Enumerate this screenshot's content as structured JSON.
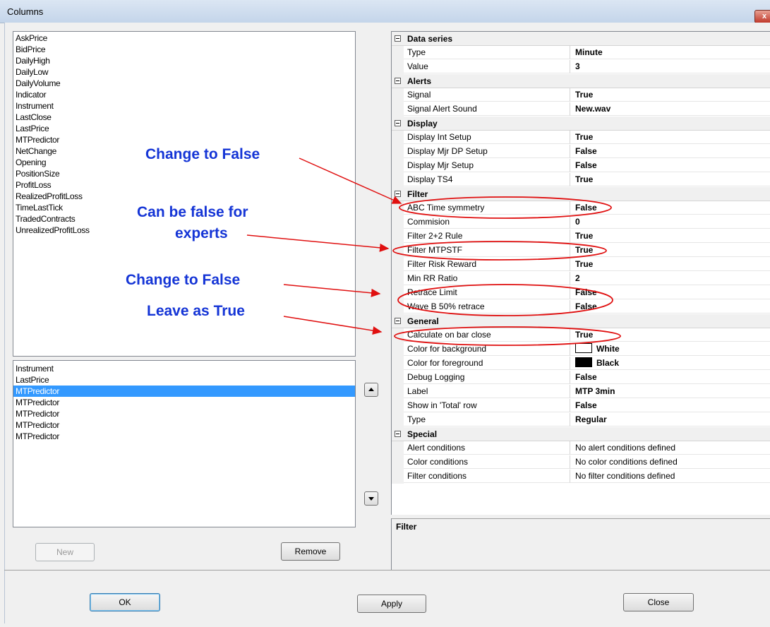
{
  "window": {
    "title": "Columns",
    "close_glyph": "x"
  },
  "available_columns": [
    "AskPrice",
    "BidPrice",
    "DailyHigh",
    "DailyLow",
    "DailyVolume",
    "Indicator",
    "Instrument",
    "LastClose",
    "LastPrice",
    "MTPredictor",
    "NetChange",
    "Opening",
    "PositionSize",
    "ProfitLoss",
    "RealizedProfitLoss",
    "TimeLastTick",
    "TradedContracts",
    "UnrealizedProfitLoss"
  ],
  "selected_columns": [
    {
      "label": "Instrument",
      "selected": false
    },
    {
      "label": "LastPrice",
      "selected": false
    },
    {
      "label": "MTPredictor",
      "selected": true
    },
    {
      "label": "MTPredictor",
      "selected": false
    },
    {
      "label": "MTPredictor",
      "selected": false
    },
    {
      "label": "MTPredictor",
      "selected": false
    },
    {
      "label": "MTPredictor",
      "selected": false
    }
  ],
  "buttons": {
    "new": "New",
    "remove": "Remove",
    "ok": "OK",
    "apply": "Apply",
    "close": "Close"
  },
  "properties": {
    "categories": [
      {
        "name": "Data series",
        "rows": [
          {
            "name": "Type",
            "value": "Minute"
          },
          {
            "name": "Value",
            "value": "3"
          }
        ]
      },
      {
        "name": "Alerts",
        "rows": [
          {
            "name": "Signal",
            "value": "True"
          },
          {
            "name": "Signal Alert Sound",
            "value": "New.wav"
          }
        ]
      },
      {
        "name": "Display",
        "rows": [
          {
            "name": "Display Int Setup",
            "value": "True"
          },
          {
            "name": "Display Mjr DP Setup",
            "value": "False"
          },
          {
            "name": "Display Mjr Setup",
            "value": "False"
          },
          {
            "name": "Display TS4",
            "value": "True"
          }
        ]
      },
      {
        "name": "Filter",
        "rows": [
          {
            "name": "ABC Time symmetry",
            "value": "False"
          },
          {
            "name": "Commision",
            "value": "0"
          },
          {
            "name": "Filter 2+2 Rule",
            "value": "True"
          },
          {
            "name": "Filter MTPSTF",
            "value": "True"
          },
          {
            "name": "Filter Risk Reward",
            "value": "True"
          },
          {
            "name": "Min RR Ratio",
            "value": "2"
          },
          {
            "name": "Retrace Limit",
            "value": "False"
          },
          {
            "name": "Wave B 50% retrace",
            "value": "False"
          }
        ]
      },
      {
        "name": "General",
        "rows": [
          {
            "name": "Calculate on bar close",
            "value": "True"
          },
          {
            "name": "Color for background",
            "value": "White",
            "swatch": "#ffffff"
          },
          {
            "name": "Color for foreground",
            "value": "Black",
            "swatch": "#000000"
          },
          {
            "name": "Debug Logging",
            "value": "False"
          },
          {
            "name": "Label",
            "value": "MTP 3min"
          },
          {
            "name": "Show in 'Total' row",
            "value": "False"
          },
          {
            "name": "Type",
            "value": "Regular"
          }
        ]
      },
      {
        "name": "Special",
        "rows": [
          {
            "name": "Alert conditions",
            "value": "No alert conditions defined",
            "plain": true
          },
          {
            "name": "Color conditions",
            "value": "No color conditions defined",
            "plain": true
          },
          {
            "name": "Filter conditions",
            "value": "No filter conditions defined",
            "plain": true
          }
        ]
      }
    ]
  },
  "description": {
    "title": "Filter"
  },
  "annotations": {
    "a1": "Change to False",
    "a2_line1": "Can be false for",
    "a2_line2": "experts",
    "a3": "Change to False",
    "a4": "Leave as True",
    "text_color": "#1535d6",
    "arrow_color": "#e01010"
  }
}
